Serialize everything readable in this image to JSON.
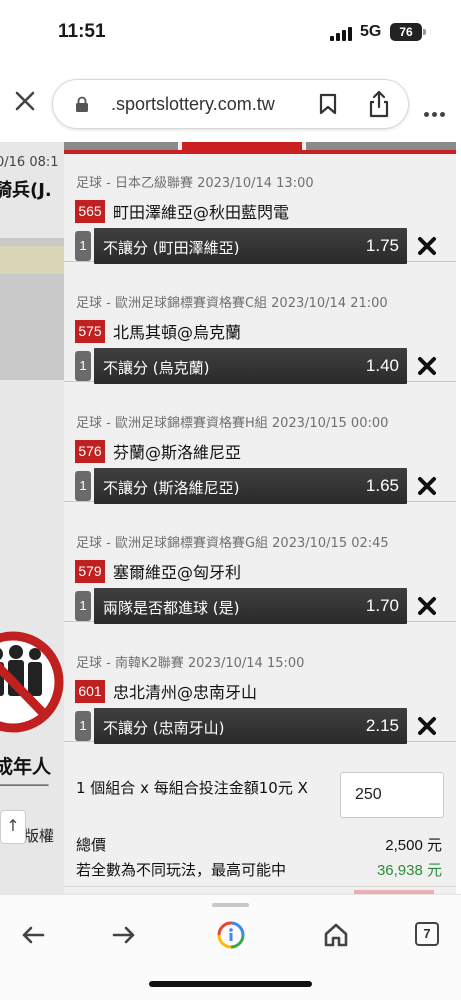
{
  "status_bar": {
    "time": "11:51",
    "network": "5G",
    "battery": "76"
  },
  "browser": {
    "url": ".sportslottery.com.tw",
    "tab_count": "7"
  },
  "background_page": {
    "date_fragment": "0/16 08:1",
    "team_fragment": "騎兵(J.",
    "caption": "成年人",
    "copyright_fragment": "版權",
    "back_to_top": "↑"
  },
  "bets": [
    {
      "league": "足球 - 日本乙級聯賽 2023/10/14 13:00",
      "code": "565",
      "match": "町田澤維亞@秋田藍閃電",
      "count": "1",
      "option": "不讓分 (町田澤維亞)",
      "odds": "1.75"
    },
    {
      "league": "足球 - 歐洲足球錦標賽資格賽C組 2023/10/14 21:00",
      "code": "575",
      "match": "北馬其頓@烏克蘭",
      "count": "1",
      "option": "不讓分 (烏克蘭)",
      "odds": "1.40"
    },
    {
      "league": "足球 - 歐洲足球錦標賽資格賽H組 2023/10/15 00:00",
      "code": "576",
      "match": "芬蘭@斯洛維尼亞",
      "count": "1",
      "option": "不讓分 (斯洛維尼亞)",
      "odds": "1.65"
    },
    {
      "league": "足球 - 歐洲足球錦標賽資格賽G組 2023/10/15 02:45",
      "code": "579",
      "match": "塞爾維亞@匈牙利",
      "count": "1",
      "option": "兩隊是否都進球 (是)",
      "odds": "1.70"
    },
    {
      "league": "足球 - 南韓K2聯賽 2023/10/14 15:00",
      "code": "601",
      "match": "忠北清州@忠南牙山",
      "count": "1",
      "option": "不讓分 (忠南牙山)",
      "odds": "2.15"
    }
  ],
  "summary": {
    "combo_text": "1 個組合 x 每組合投注金額10元 X",
    "amount": "250",
    "total_label": "總價",
    "total_value": "2,500 元",
    "max_label": "若全數為不同玩法，最高可能中",
    "max_value": "36,938 元"
  },
  "colors": {
    "accent_red": "#cc1f1f",
    "win_green": "#2e8b3a",
    "bar_dark": "#333333"
  }
}
